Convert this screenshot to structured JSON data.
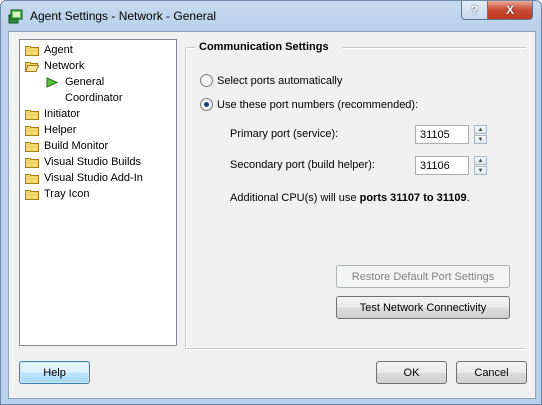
{
  "window": {
    "title": "Agent Settings - Network - General"
  },
  "titlebar": {
    "help_glyph": "?",
    "close_glyph": "X"
  },
  "tree": {
    "items": [
      {
        "label": "Agent",
        "icon": "folder-icon"
      },
      {
        "label": "Network",
        "icon": "folder-open-icon"
      },
      {
        "label": "General",
        "icon": "arrow-icon",
        "selected": true
      },
      {
        "label": "Coordinator",
        "icon": ""
      },
      {
        "label": "Initiator",
        "icon": "folder-icon"
      },
      {
        "label": "Helper",
        "icon": "folder-icon"
      },
      {
        "label": "Build Monitor",
        "icon": "folder-icon"
      },
      {
        "label": "Visual Studio Builds",
        "icon": "folder-icon"
      },
      {
        "label": "Visual Studio Add-In",
        "icon": "folder-icon"
      },
      {
        "label": "Tray Icon",
        "icon": "folder-icon"
      }
    ]
  },
  "settings": {
    "section_title": "Communication Settings",
    "radio_auto": "Select ports automatically",
    "radio_manual": "Use these port numbers (recommended):",
    "selected_radio": "manual",
    "primary_label": "Primary port (service):",
    "primary_value": "31105",
    "secondary_label": "Secondary port (build helper):",
    "secondary_value": "31106",
    "additional_prefix": "Additional CPU(s) will use ",
    "additional_ports": "ports 31107 to 31109",
    "additional_suffix": ".",
    "restore_button": "Restore Default Port Settings",
    "test_button": "Test Network Connectivity"
  },
  "footer": {
    "help_button": "Help",
    "ok_button": "OK",
    "cancel_button": "Cancel"
  },
  "colors": {
    "folder": "#e8c24a",
    "arrow": "#3aa017",
    "frame": "#b9d1ea"
  }
}
